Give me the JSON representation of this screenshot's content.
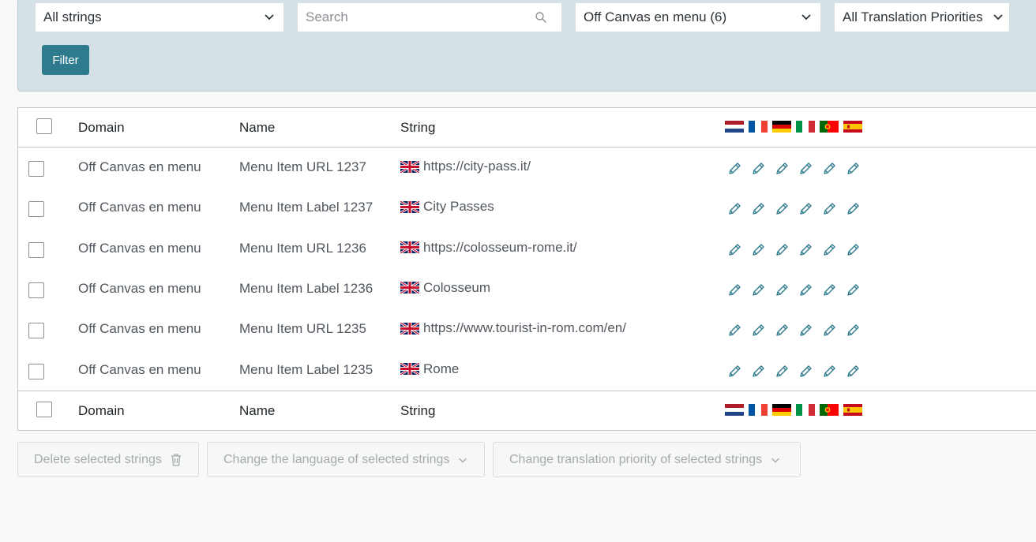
{
  "filters": {
    "string_status": "All strings",
    "search_placeholder": "Search",
    "domain_select": "Off Canvas en menu (6)",
    "priority_select": "All Translation Priorities",
    "filter_button": "Filter"
  },
  "table": {
    "columns": {
      "domain": "Domain",
      "name": "Name",
      "string": "String"
    },
    "language_flags": [
      "nl-flag-icon",
      "fr-flag-icon",
      "de-flag-icon",
      "it-flag-icon",
      "pt-flag-icon",
      "es-flag-icon"
    ],
    "rows": [
      {
        "domain": "Off Canvas en menu",
        "name": "Menu Item URL 1237",
        "string": "https://city-pass.it/"
      },
      {
        "domain": "Off Canvas en menu",
        "name": "Menu Item Label 1237",
        "string": "City Passes"
      },
      {
        "domain": "Off Canvas en menu",
        "name": "Menu Item URL 1236",
        "string": "https://colosseum-rome.it/"
      },
      {
        "domain": "Off Canvas en menu",
        "name": "Menu Item Label 1236",
        "string": "Colosseum"
      },
      {
        "domain": "Off Canvas en menu",
        "name": "Menu Item URL 1235",
        "string": "https://www.tourist-in-rom.com/en/"
      },
      {
        "domain": "Off Canvas en menu",
        "name": "Menu Item Label 1235",
        "string": "Rome"
      }
    ]
  },
  "bulk_actions": {
    "delete": "Delete selected strings",
    "change_language": "Change the language of selected strings",
    "change_priority": "Change translation priority of selected strings"
  },
  "colors": {
    "accent": "#2e7b8d",
    "panel": "#d4e1e6",
    "pencil": "#2e7b8d"
  }
}
